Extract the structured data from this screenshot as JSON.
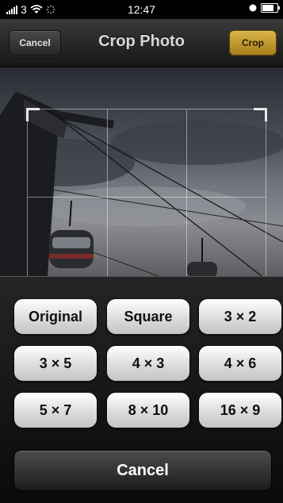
{
  "status_bar": {
    "carrier": "3",
    "time": "12:47",
    "battery_level": 0.8
  },
  "nav": {
    "cancel_label": "Cancel",
    "title": "Crop Photo",
    "crop_label": "Crop"
  },
  "ratios": [
    {
      "label": "Original"
    },
    {
      "label": "Square"
    },
    {
      "label": "3 × 2"
    },
    {
      "label": "3 × 5"
    },
    {
      "label": "4 × 3"
    },
    {
      "label": "4 × 6"
    },
    {
      "label": "5 × 7"
    },
    {
      "label": "8 × 10"
    },
    {
      "label": "16 × 9"
    }
  ],
  "sheet": {
    "cancel_label": "Cancel"
  },
  "icons": {
    "signal": "signal-bars-icon",
    "wifi": "wifi-icon",
    "activity": "activity-spinner-icon",
    "location": "location-icon",
    "battery": "battery-icon"
  },
  "colors": {
    "crop_button": "#c99e2f",
    "nav_background": "#262626",
    "ratio_button": "#e6e6e6"
  }
}
